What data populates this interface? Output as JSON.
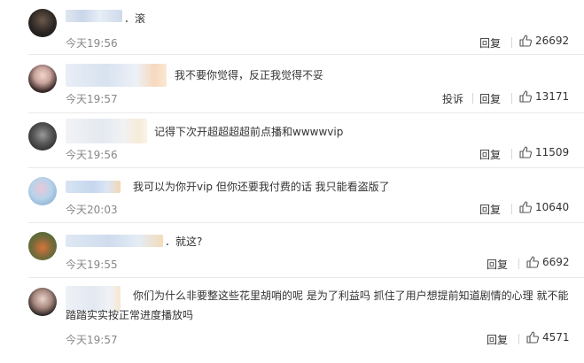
{
  "comments": [
    {
      "text": "．滚",
      "time": "今天19:56",
      "reply": "回复",
      "likes": "26692"
    },
    {
      "text": "我不要你觉得，反正我觉得不妥",
      "time": "今天19:57",
      "report": "投诉",
      "reply": "回复",
      "likes": "13171"
    },
    {
      "text": "记得下次开超超超超前点播和wwwwvip",
      "time": "今天19:56",
      "reply": "回复",
      "likes": "11509"
    },
    {
      "text": "我可以为你开vip 但你还要我付费的话 我只能看盗版了",
      "time": "今天20:03",
      "reply": "回复",
      "likes": "10640"
    },
    {
      "text": "．就这?",
      "time": "今天19:55",
      "reply": "回复",
      "likes": "6692"
    },
    {
      "text_line1": "你们为什么非要整这些花里胡哨的呢 是为了利益吗 抓住了用户想提前知道剧情的心理 就不能",
      "text_line2": "踏踏实实按正常进度播放吗",
      "time": "今天19:57",
      "reply": "回复",
      "likes": "4571"
    }
  ],
  "icons": {
    "like": "thumbs-up-icon"
  },
  "colors": {
    "separator": "#e9e9e9",
    "time": "#888888",
    "text": "#333333"
  }
}
